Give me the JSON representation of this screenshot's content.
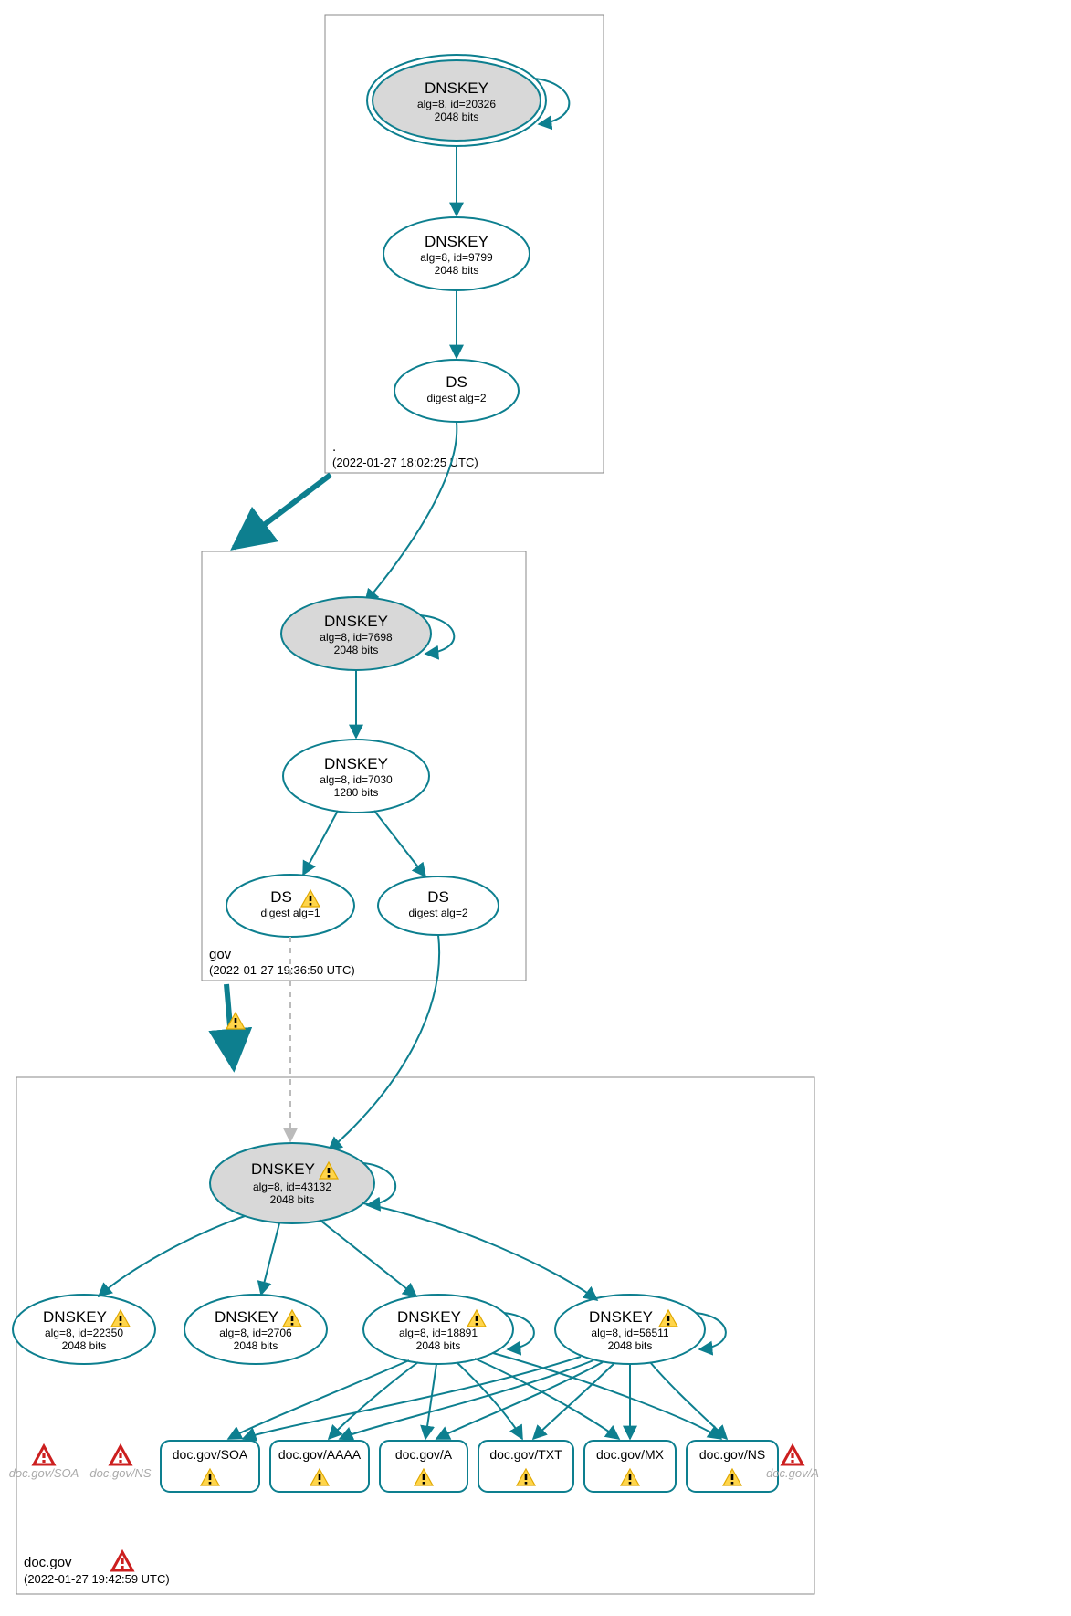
{
  "colors": {
    "stroke": "#0d7f8f",
    "ksk_fill": "#d8d8d8"
  },
  "icons": {
    "warn": "warning-icon",
    "err": "error-icon"
  },
  "zones": {
    "root": {
      "label": ".",
      "timestamp": "(2022-01-27 18:02:25 UTC)",
      "nodes": {
        "ksk": {
          "title": "DNSKEY",
          "sub1": "alg=8, id=20326",
          "sub2": "2048 bits"
        },
        "zsk": {
          "title": "DNSKEY",
          "sub1": "alg=8, id=9799",
          "sub2": "2048 bits"
        },
        "ds": {
          "title": "DS",
          "sub1": "digest alg=2"
        }
      }
    },
    "gov": {
      "label": "gov",
      "timestamp": "(2022-01-27 19:36:50 UTC)",
      "nodes": {
        "ksk": {
          "title": "DNSKEY",
          "sub1": "alg=8, id=7698",
          "sub2": "2048 bits"
        },
        "zsk": {
          "title": "DNSKEY",
          "sub1": "alg=8, id=7030",
          "sub2": "1280 bits"
        },
        "ds1": {
          "title": "DS",
          "sub1": "digest alg=1",
          "warn": true
        },
        "ds2": {
          "title": "DS",
          "sub1": "digest alg=2"
        }
      }
    },
    "docgov": {
      "label": "doc.gov",
      "timestamp": "(2022-01-27 19:42:59 UTC)",
      "label_warn": true,
      "nodes": {
        "ksk": {
          "title": "DNSKEY",
          "sub1": "alg=8, id=43132",
          "sub2": "2048 bits",
          "warn": true
        },
        "k1": {
          "title": "DNSKEY",
          "sub1": "alg=8, id=22350",
          "sub2": "2048 bits",
          "warn": true
        },
        "k2": {
          "title": "DNSKEY",
          "sub1": "alg=8, id=2706",
          "sub2": "2048 bits",
          "warn": true
        },
        "k3": {
          "title": "DNSKEY",
          "sub1": "alg=8, id=18891",
          "sub2": "2048 bits",
          "warn": true
        },
        "k4": {
          "title": "DNSKEY",
          "sub1": "alg=8, id=56511",
          "sub2": "2048 bits",
          "warn": true
        }
      },
      "records": {
        "r1": {
          "label": "doc.gov/SOA",
          "warn": true
        },
        "r2": {
          "label": "doc.gov/AAAA",
          "warn": true
        },
        "r3": {
          "label": "doc.gov/A",
          "warn": true
        },
        "r4": {
          "label": "doc.gov/TXT",
          "warn": true
        },
        "r5": {
          "label": "doc.gov/MX",
          "warn": true
        },
        "r6": {
          "label": "doc.gov/NS",
          "warn": true
        }
      },
      "ghosts": {
        "g1": "doc.gov/SOA",
        "g2": "doc.gov/NS",
        "g3": "doc.gov/A"
      }
    }
  }
}
